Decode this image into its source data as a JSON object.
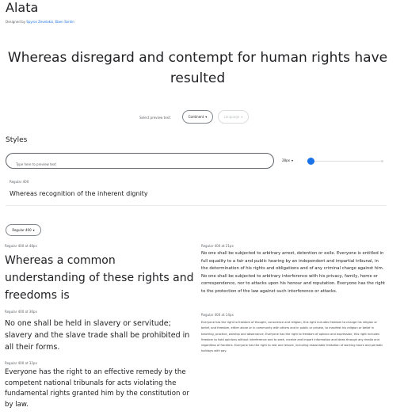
{
  "font": {
    "name": "Alata",
    "designed_by_label": "Designed by",
    "designers": "Spyros Zevelakis, Eben Sorkin"
  },
  "hero": {
    "text": "Whereas disregard and contempt for human rights have resulted"
  },
  "preview_controls": {
    "label": "Select preview text:",
    "continent_label": "Continent",
    "language_label": "Language"
  },
  "styles": {
    "heading": "Styles",
    "search_placeholder": "Type here to preview text",
    "size_value": "28px",
    "size_fraction": 0.0,
    "style_label": "Regular 400",
    "style_sample": "Whereas recognition of the inherent dignity",
    "weight_select": "Regular 400"
  },
  "samples": {
    "left": [
      {
        "meta": "Regular 400 at 48px",
        "text": "Whereas a common understanding of these rights and freedoms is"
      },
      {
        "meta": "Regular 400 at 36px",
        "text": "No one shall be held in slavery or servitude; slavery and the slave trade shall be prohibited in all their forms."
      },
      {
        "meta": "Regular 400 at 32px",
        "text": "Everyone has the right to an effective remedy by the competent national tribunals for acts violating the fundamental rights granted him by the constitution or by law."
      }
    ],
    "right": [
      {
        "meta": "Regular 400 at 21px",
        "text": "No one shall be subjected to arbitrary arrest, detention or exile. Everyone is entitled in full equality to a fair and public hearing by an independent and impartial tribunal, in the determination of his rights and obligations and of any criminal charge against him. No one shall be subjected to arbitrary interference with his privacy, family, home or correspondence, nor to attacks upon his honour and reputation. Everyone has the right to the protection of the law against such interference or attacks."
      },
      {
        "meta": "Regular 400 at 14px",
        "text": "Everyone has the right to freedom of thought, conscience and religion; this right includes freedom to change his religion or belief, and freedom, either alone or in community with others and in public or private, to manifest his religion or belief in teaching, practice, worship and observance. Everyone has the right to freedom of opinion and expression; this right includes freedom to hold opinions without interference and to seek, receive and impart information and ideas through any media and regardless of frontiers. Everyone has the right to rest and leisure, including reasonable limitation of working hours and periodic holidays with pay."
      }
    ]
  },
  "colors": {
    "accent": "#1a73e8",
    "text": "#202124",
    "muted": "#5f6368"
  }
}
